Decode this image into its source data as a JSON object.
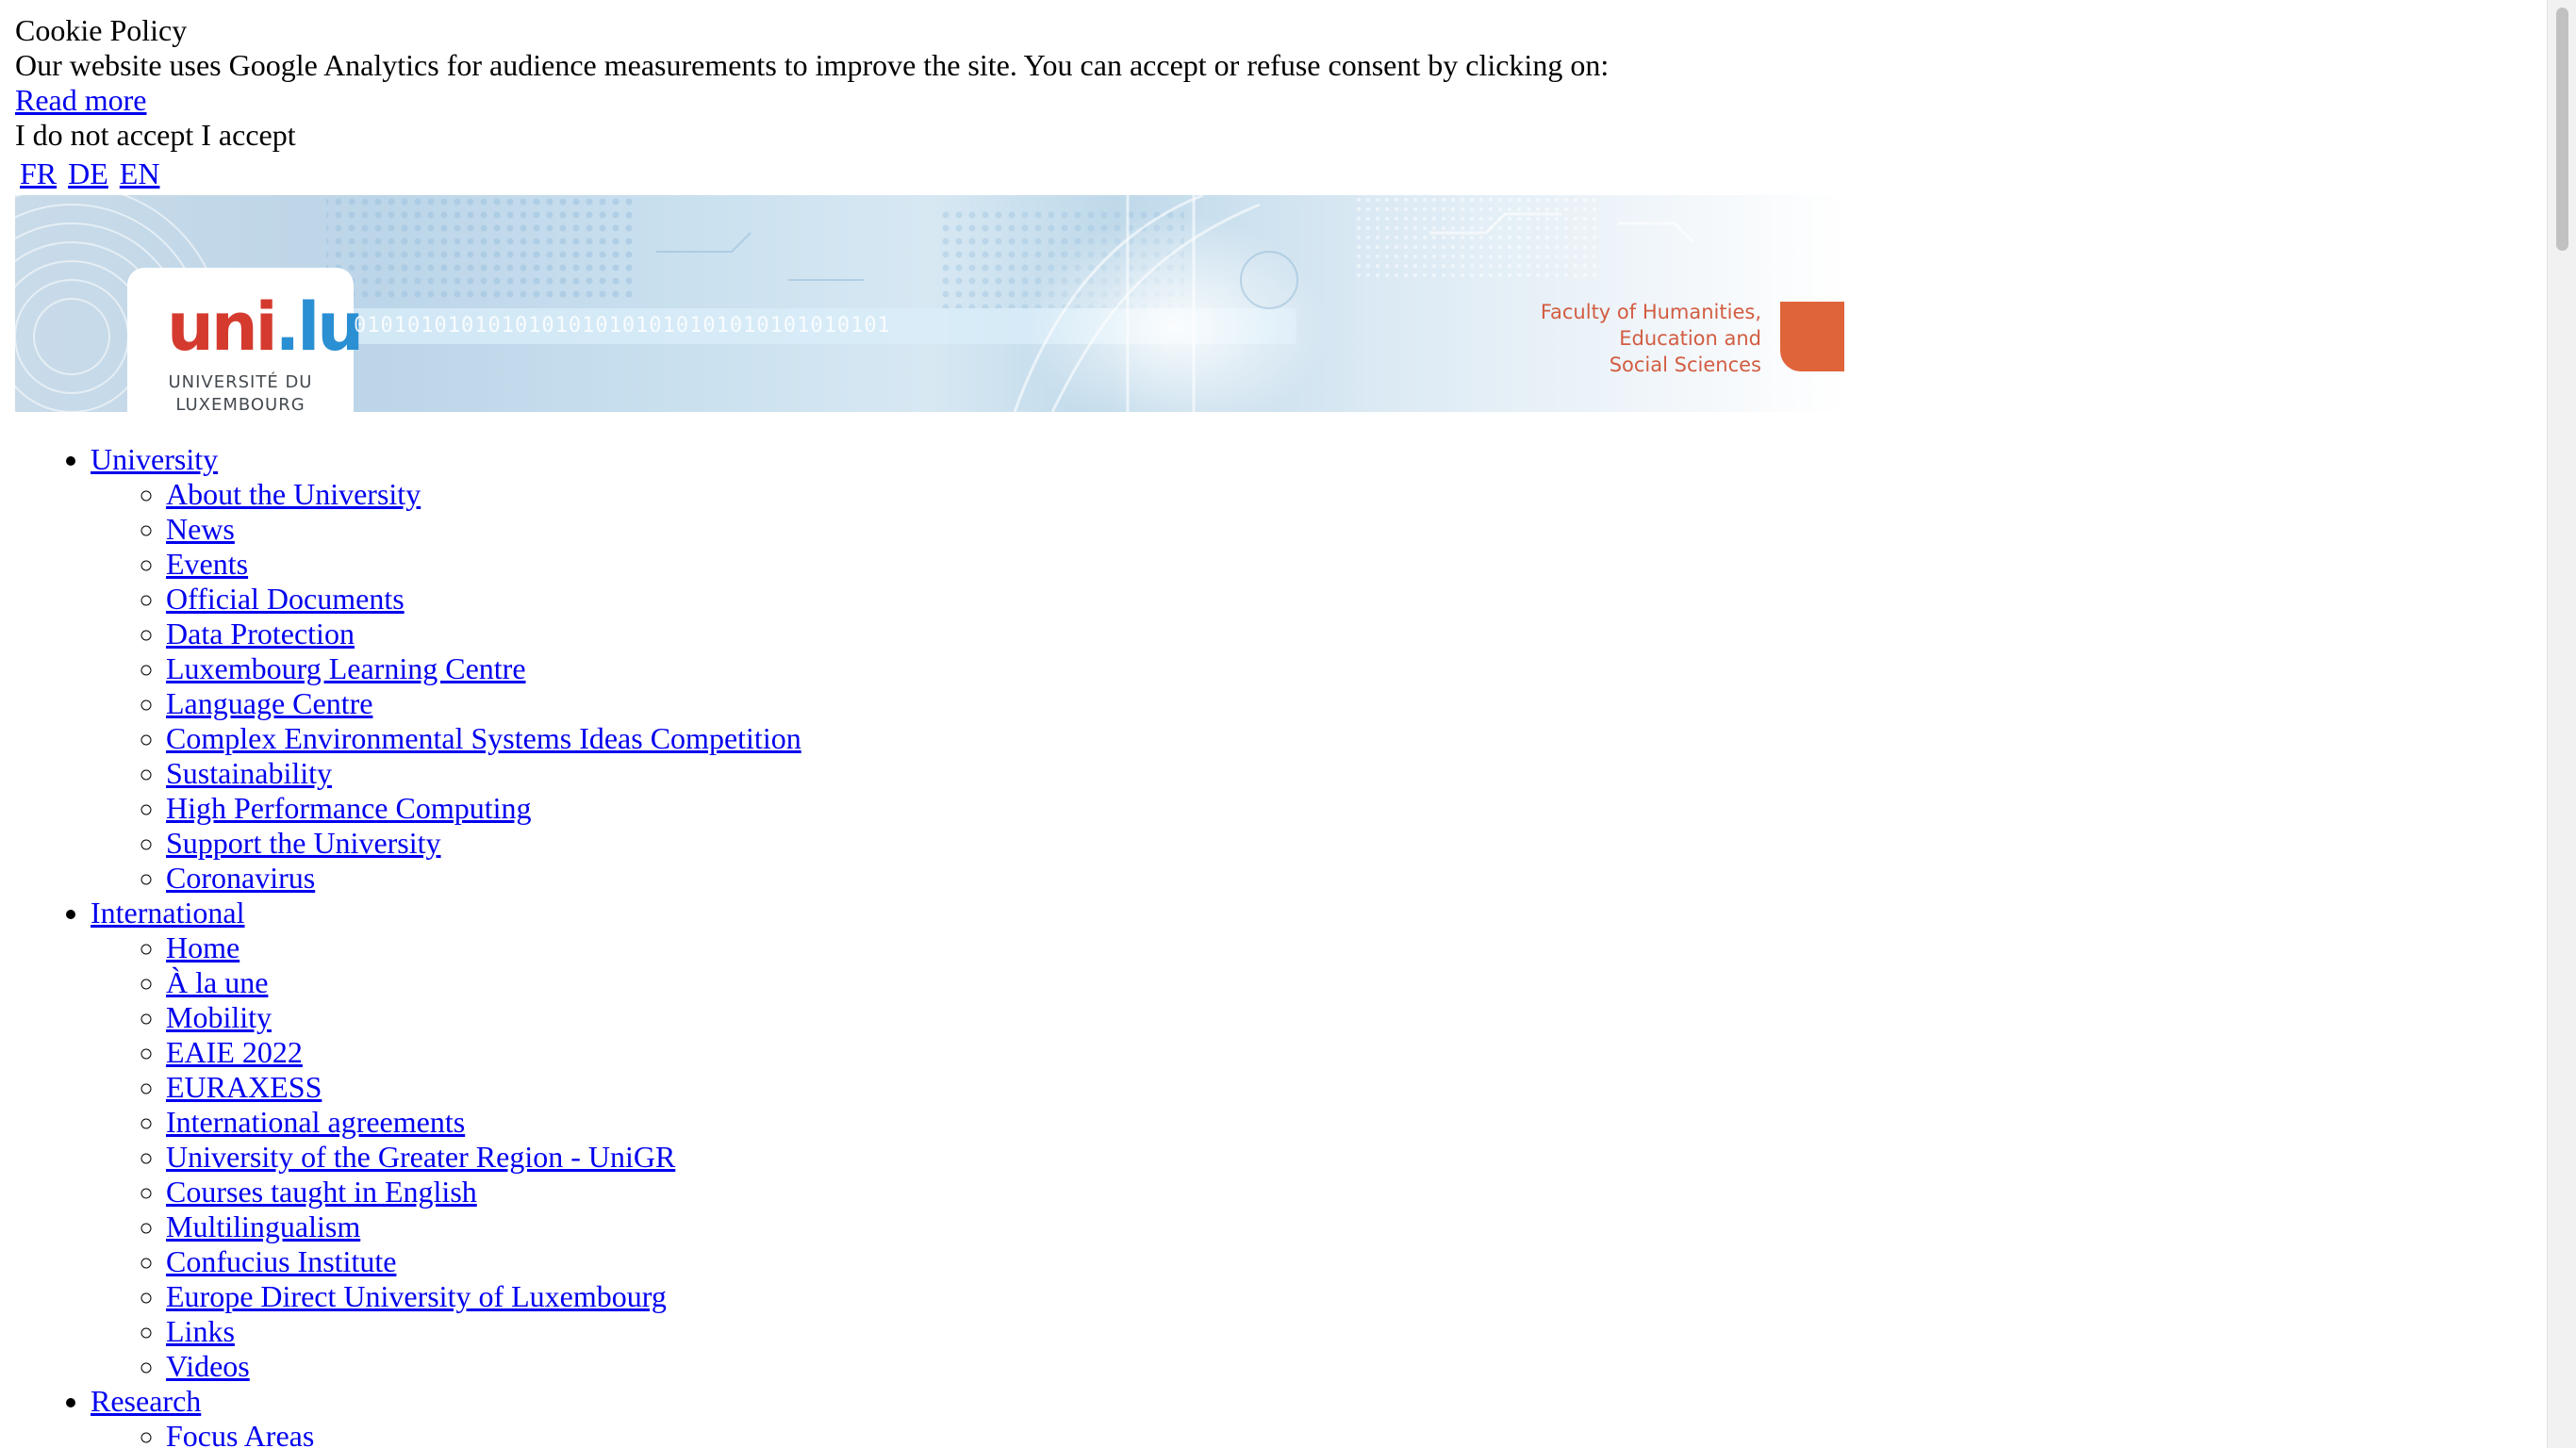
{
  "cookie": {
    "title": "Cookie Policy",
    "text": "Our website uses Google Analytics for audience measurements to improve the site. You can accept or refuse consent by clicking on:",
    "read_more": "Read more",
    "refuse": "I do not accept",
    "accept": "I accept"
  },
  "languages": [
    "FR",
    "DE",
    "EN"
  ],
  "banner": {
    "logo_red": "uni",
    "logo_dot": ".",
    "logo_blue": "lu",
    "logo_line1": "UNIVERSITÉ DU",
    "logo_line2": "LUXEMBOURG",
    "binary": "0101010101010101010101010101010101010101",
    "faculty_line1": "Faculty of Humanities,",
    "faculty_line2": "Education and",
    "faculty_line3": "Social Sciences",
    "colors": {
      "logo_red": "#d53a2f",
      "logo_blue": "#2a8fd3",
      "faculty_orange": "#e0643a"
    }
  },
  "nav": [
    {
      "label": "University",
      "items": [
        "About the University",
        "News",
        "Events",
        "Official Documents",
        "Data Protection",
        "Luxembourg Learning Centre",
        "Language Centre",
        "Complex Environmental Systems Ideas Competition",
        "Sustainability",
        "High Performance Computing",
        "Support the University",
        "Coronavirus"
      ]
    },
    {
      "label": "International",
      "items": [
        "Home",
        "À la une",
        "Mobility",
        "EAIE 2022",
        "EURAXESS",
        "International agreements",
        "University of the Greater Region - UniGR",
        "Courses taught in English",
        "Multilingualism",
        "Confucius Institute",
        "Europe Direct University of Luxembourg",
        "Links",
        "Videos"
      ]
    },
    {
      "label": "Research",
      "items": [
        "Focus Areas"
      ]
    }
  ],
  "link_color": "#0000ee"
}
